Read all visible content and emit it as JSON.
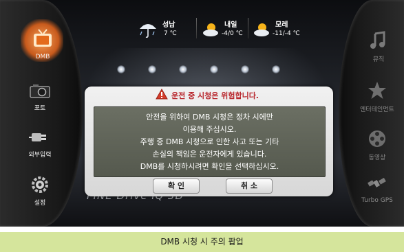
{
  "weather": [
    {
      "day": "성남",
      "temp": "7 ℃",
      "icon_name": "rain-umbrella-icon"
    },
    {
      "day": "내일",
      "temp": "-4/0 ℃",
      "icon_name": "cloud-sun-icon"
    },
    {
      "day": "모레",
      "temp": "-11/-4 ℃",
      "icon_name": "cloud-sun-icon"
    }
  ],
  "left_menu": [
    {
      "label": "DMB",
      "icon_name": "tv-icon",
      "selected": true
    },
    {
      "label": "포토",
      "icon_name": "camera-icon",
      "selected": false
    },
    {
      "label": "외부입력",
      "icon_name": "plug-icon",
      "selected": false
    },
    {
      "label": "설정",
      "icon_name": "gear-icon",
      "selected": false
    }
  ],
  "right_menu": [
    {
      "label": "뮤직",
      "icon_name": "music-note-icon"
    },
    {
      "label": "엔터테인먼트",
      "icon_name": "star-icon"
    },
    {
      "label": "동영상",
      "icon_name": "film-reel-icon"
    },
    {
      "label": "Turbo GPS",
      "icon_name": "satellite-icon"
    }
  ],
  "dialog": {
    "title": "운전 중 시청은 위험합니다.",
    "lines": [
      "안전을 위하여 DMB 시청은 정차 시에만",
      "이용해 주십시오.",
      "주행 중 DMB 시청으로 인한 사고 또는 기타",
      "손실의 책임은 운전자에게 있습니다.",
      "DMB를 시청하시려면 확인을 선택하십시오."
    ],
    "confirm_label": "확 인",
    "cancel_label": "취 소"
  },
  "logo": {
    "text": "FINE Drive iQ 3D"
  },
  "caption": "DMB 시청 시 주의 팝업",
  "colors": {
    "selected_orange": "#e07a2f",
    "dialog_title_red": "#b8262c",
    "dialog_body_bg": "#5f6358",
    "caption_bg": "#d5e59c"
  }
}
